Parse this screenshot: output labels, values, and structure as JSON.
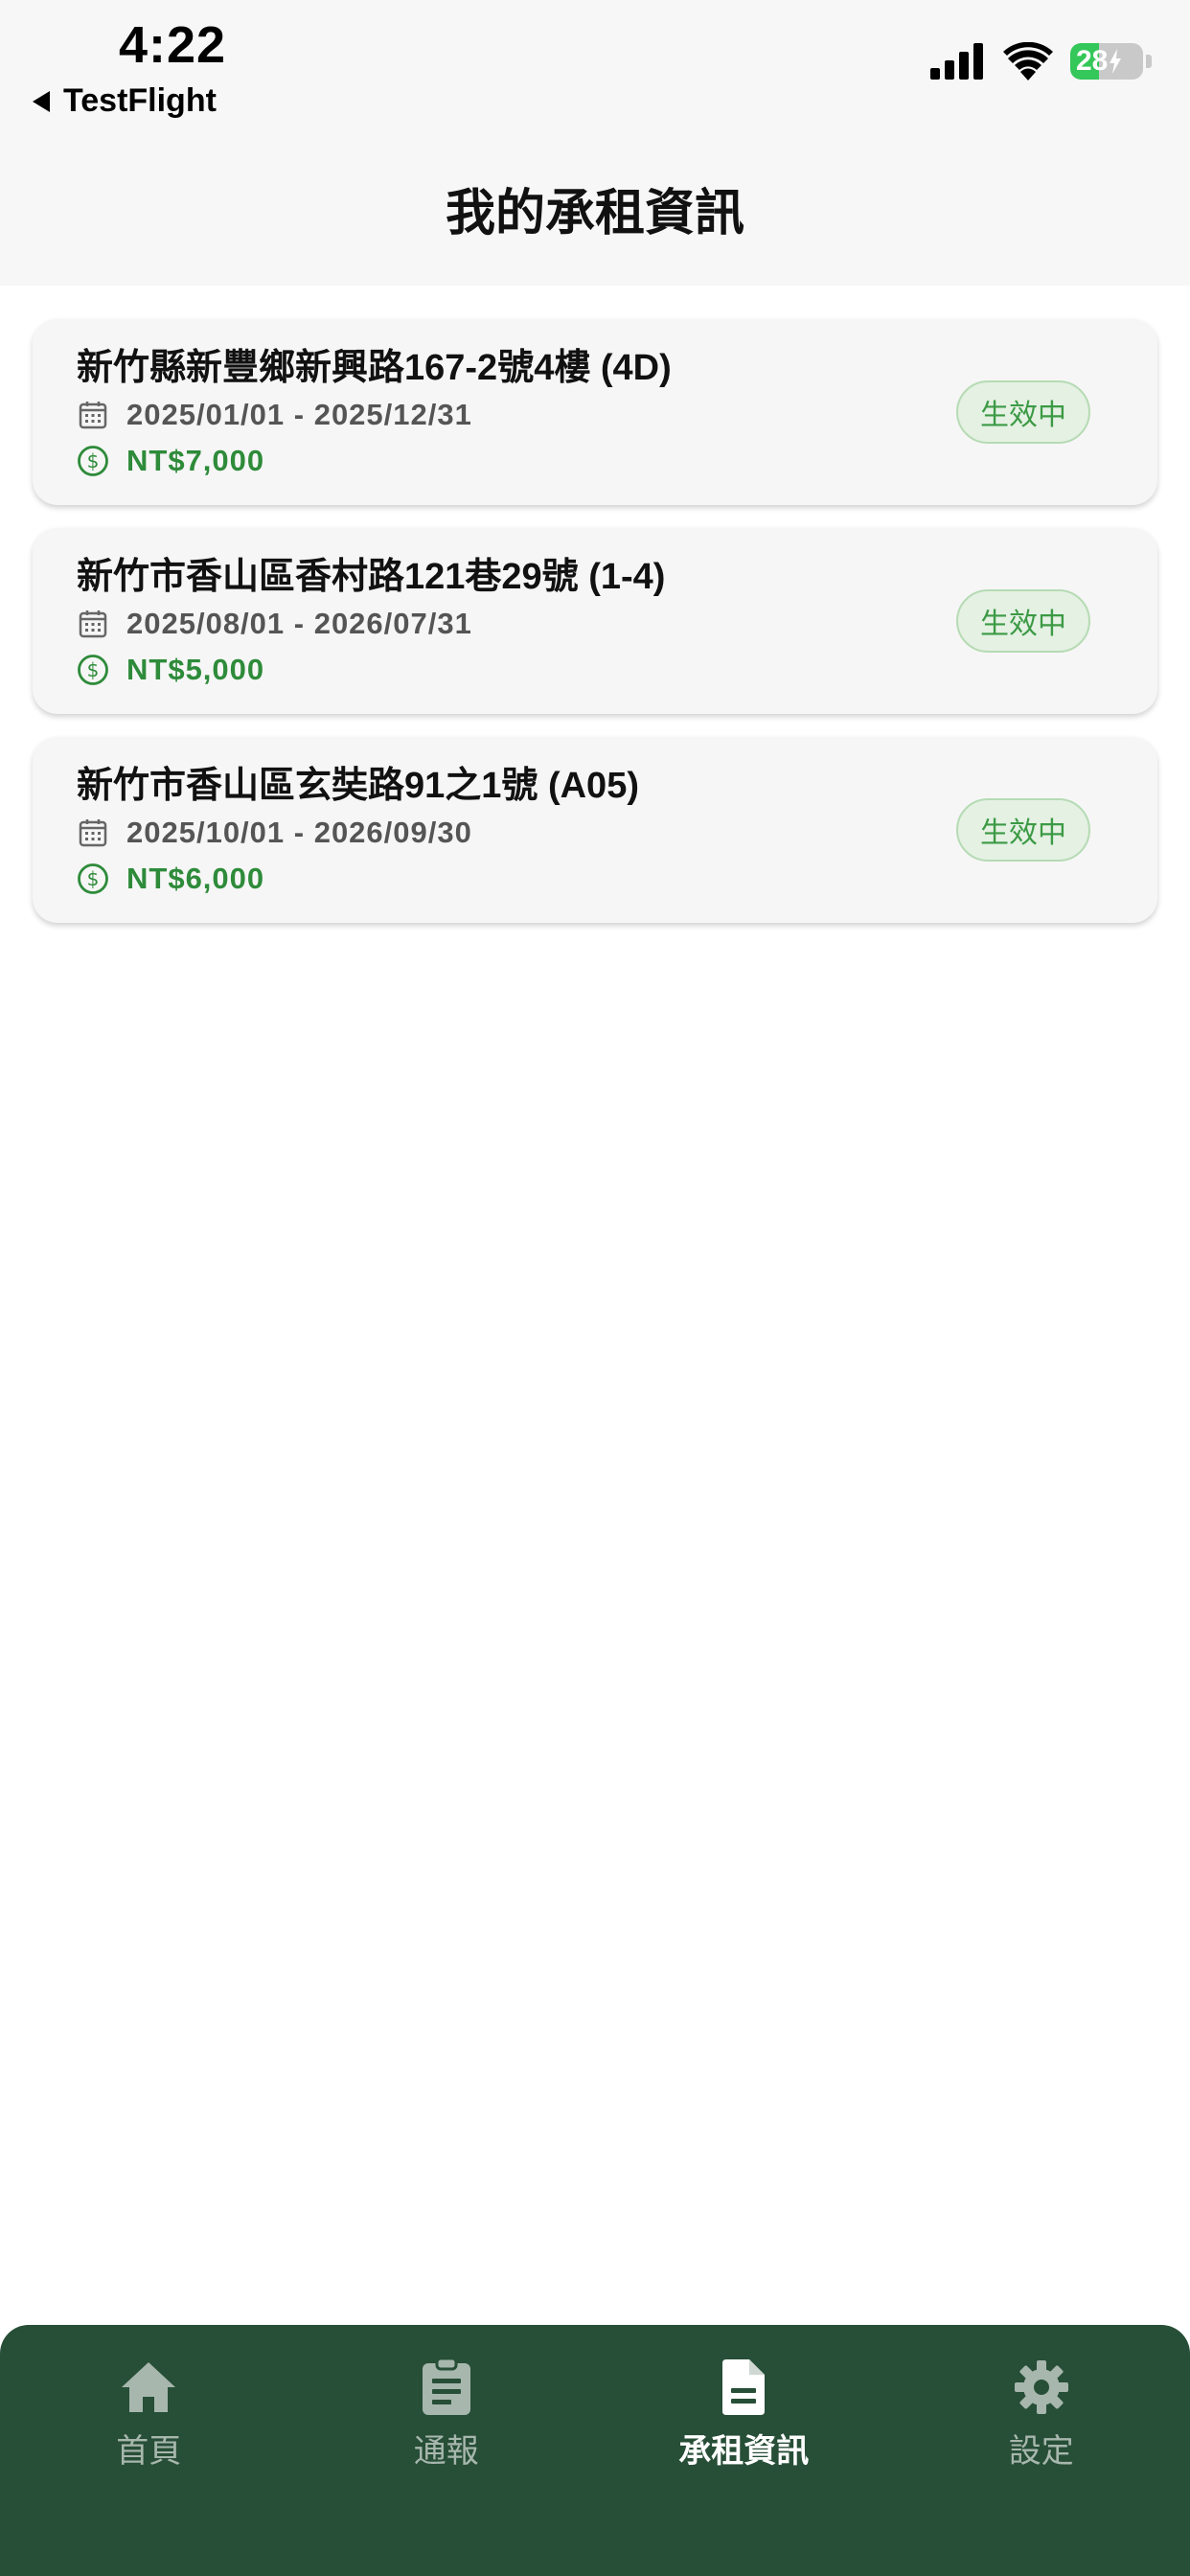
{
  "status_bar": {
    "time": "4:22",
    "back_label": "TestFlight",
    "battery_level": "28",
    "battery_fraction": 0.28,
    "icons": [
      "cellular-signal-icon",
      "wifi-icon",
      "battery-charging-icon"
    ]
  },
  "header": {
    "title": "我的承租資訊"
  },
  "leases": [
    {
      "address": "新竹縣新豐鄉新興路167-2號4樓 (4D)",
      "period": "2025/01/01 - 2025/12/31",
      "rent": "NT$7,000",
      "status": "生效中"
    },
    {
      "address": "新竹市香山區香村路121巷29號 (1-4)",
      "period": "2025/08/01 - 2026/07/31",
      "rent": "NT$5,000",
      "status": "生效中"
    },
    {
      "address": "新竹市香山區玄奘路91之1號 (A05)",
      "period": "2025/10/01 - 2026/09/30",
      "rent": "NT$6,000",
      "status": "生效中"
    }
  ],
  "tab_bar": {
    "items": [
      {
        "label": "首頁",
        "icon": "home-icon",
        "active": false
      },
      {
        "label": "通報",
        "icon": "clipboard-icon",
        "active": false
      },
      {
        "label": "承租資訊",
        "icon": "document-icon",
        "active": true
      },
      {
        "label": "設定",
        "icon": "gear-icon",
        "active": false
      }
    ]
  },
  "colors": {
    "tab_bar_bg": "#274e37",
    "accent_green": "#2e8b3a",
    "badge_bg": "#e4f1e3",
    "battery_green": "#34c759"
  }
}
